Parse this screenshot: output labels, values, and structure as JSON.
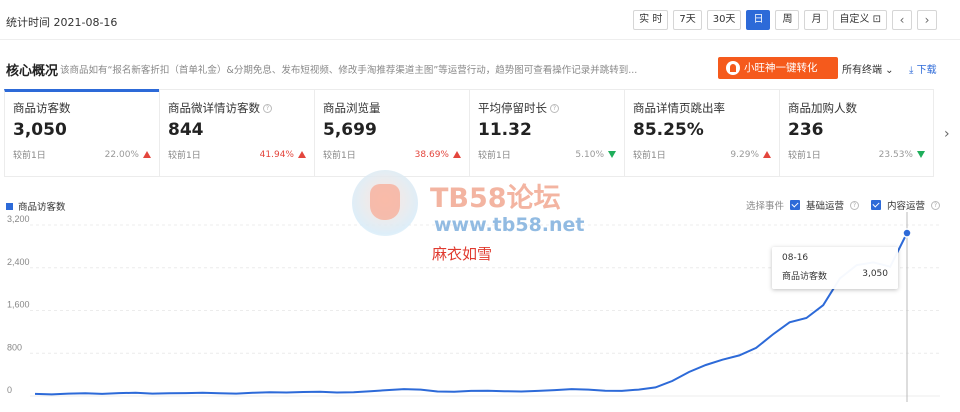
{
  "header": {
    "stat_time": "统计时间 2021-08-16",
    "periods": [
      {
        "label": "实 时",
        "active": false
      },
      {
        "label": "7天",
        "active": false
      },
      {
        "label": "30天",
        "active": false
      },
      {
        "label": "日",
        "active": true
      },
      {
        "label": "周",
        "active": false
      },
      {
        "label": "月",
        "active": false
      },
      {
        "label": "自定义 ⊡",
        "active": false
      }
    ],
    "prev_label": "‹",
    "next_label": "›"
  },
  "core": {
    "title": "核心概况",
    "description": "该商品如有“报名新客折扣（首单礼金）&分期免息、发布短视频、修改手淘推荐渠道主图”等运营行动，趋势图可查看操作记录并跳转到...",
    "convert_button": "小旺神一键转化",
    "terminal_select": "所有终端 ⌄",
    "download": "⤓ 下载"
  },
  "cards": [
    {
      "label": "商品访客数",
      "value": "3,050",
      "compare": "较前1日",
      "change": "22.00%",
      "dir": "up",
      "active": true,
      "help": false,
      "pct_style": "up"
    },
    {
      "label": "商品微详情访客数",
      "value": "844",
      "compare": "较前1日",
      "change": "41.94%",
      "dir": "up",
      "active": false,
      "help": true,
      "pct_style": "red"
    },
    {
      "label": "商品浏览量",
      "value": "5,699",
      "compare": "较前1日",
      "change": "38.69%",
      "dir": "up",
      "active": false,
      "help": false,
      "pct_style": "red"
    },
    {
      "label": "平均停留时长",
      "value": "11.32",
      "compare": "较前1日",
      "change": "5.10%",
      "dir": "down",
      "active": false,
      "help": true,
      "pct_style": "up"
    },
    {
      "label": "商品详情页跳出率",
      "value": "85.25%",
      "compare": "较前1日",
      "change": "9.29%",
      "dir": "up",
      "active": false,
      "help": false,
      "pct_style": "up"
    },
    {
      "label": "商品加购人数",
      "value": "236",
      "compare": "较前1日",
      "change": "23.53%",
      "dir": "down",
      "active": false,
      "help": false,
      "pct_style": "up"
    }
  ],
  "cards_next": "›",
  "legend": {
    "series_name": "商品访客数",
    "events_label": "选择事件",
    "event_basic": "基础运营",
    "event_content": "内容运营"
  },
  "watermark": {
    "title": "TB58论坛",
    "url": "www.tb58.net",
    "name": "麻衣如雪"
  },
  "tooltip": {
    "date": "08-16",
    "series": "商品访客数",
    "value": "3,050"
  },
  "colors": {
    "accent": "#2d6ad8",
    "convert": "#f55a1c",
    "up": "#e3463d",
    "down": "#1fae5b"
  },
  "chart_data": {
    "type": "line",
    "ylim": [
      0,
      3200
    ],
    "yticks": [
      "3,200",
      "2,400",
      "1,600",
      "800",
      "0"
    ],
    "series": [
      {
        "name": "商品访客数",
        "values": [
          40,
          30,
          45,
          50,
          40,
          55,
          60,
          45,
          50,
          55,
          60,
          50,
          45,
          60,
          70,
          65,
          75,
          80,
          65,
          70,
          90,
          110,
          130,
          120,
          85,
          80,
          95,
          100,
          90,
          85,
          95,
          110,
          130,
          120,
          100,
          95,
          120,
          160,
          280,
          450,
          580,
          680,
          760,
          900,
          1150,
          1380,
          1460,
          1700,
          2200,
          2450,
          2500,
          2420,
          3050
        ]
      }
    ],
    "x_range": [
      "2021-06-25",
      "2021-08-16"
    ]
  }
}
